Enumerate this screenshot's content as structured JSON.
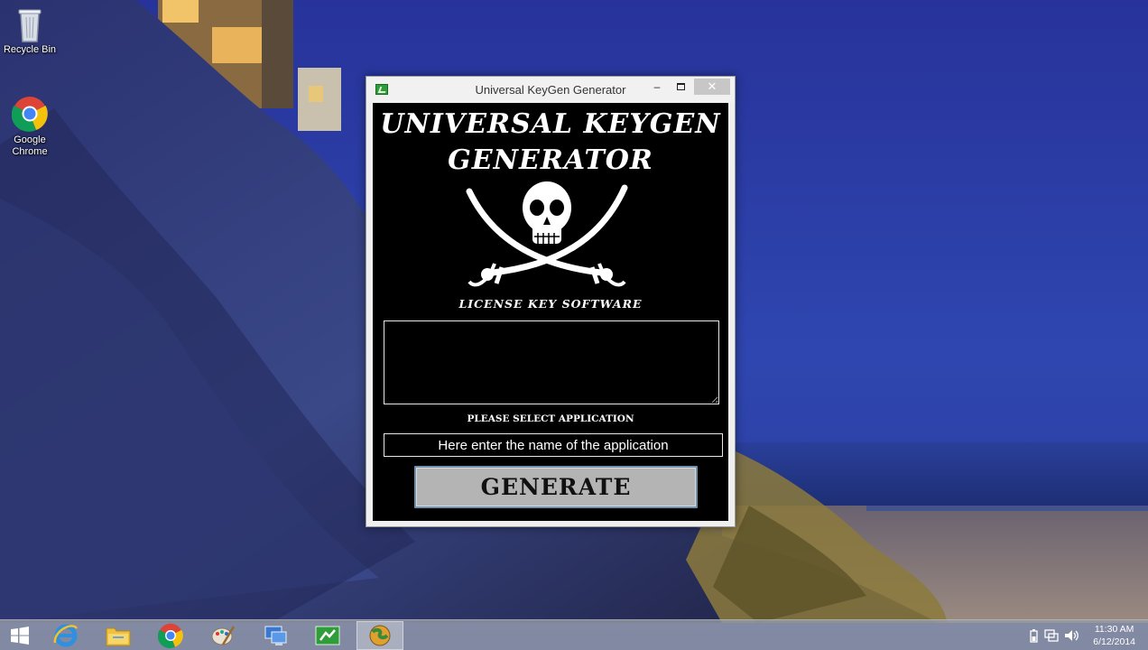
{
  "desktop": {
    "icons": [
      {
        "label": "Recycle Bin",
        "icon": "recycle-bin-icon"
      },
      {
        "label": "Google Chrome",
        "icon": "chrome-icon"
      }
    ]
  },
  "window": {
    "title": "Universal KeyGen Generator",
    "controls": {
      "minimize": "–",
      "maximize": "",
      "close": "✕"
    },
    "brand_title_line1": "UNIVERSAL KEYGEN",
    "brand_title_line2": "GENERATOR",
    "emblem_icon": "skull-crossed-swords-icon",
    "tagline": "LICENSE KEY SOFTWARE",
    "key_output_value": "",
    "select_label": "PLEASE SELECT APPLICATION",
    "app_name_placeholder": "Here enter the name of the application",
    "generate_label": "GENERATE"
  },
  "taskbar": {
    "items": [
      {
        "icon": "windows-start-icon",
        "active": false
      },
      {
        "icon": "internet-explorer-icon",
        "active": false
      },
      {
        "icon": "file-explorer-icon",
        "active": false
      },
      {
        "icon": "chrome-icon",
        "active": false
      },
      {
        "icon": "paint-icon",
        "active": false
      },
      {
        "icon": "remote-desktop-icon",
        "active": false
      },
      {
        "icon": "keygen-app-icon",
        "active": false
      },
      {
        "icon": "globe-app-icon",
        "active": true
      }
    ],
    "tray_icons": [
      "battery-icon",
      "network-icon",
      "volume-icon"
    ],
    "time": "11:30 AM",
    "date": "6/12/2014"
  },
  "colors": {
    "window_client_bg": "#000000",
    "generate_button_bg": "#b4b4b4",
    "sky": "#2a3a9c",
    "sea": "#1d2c78"
  }
}
